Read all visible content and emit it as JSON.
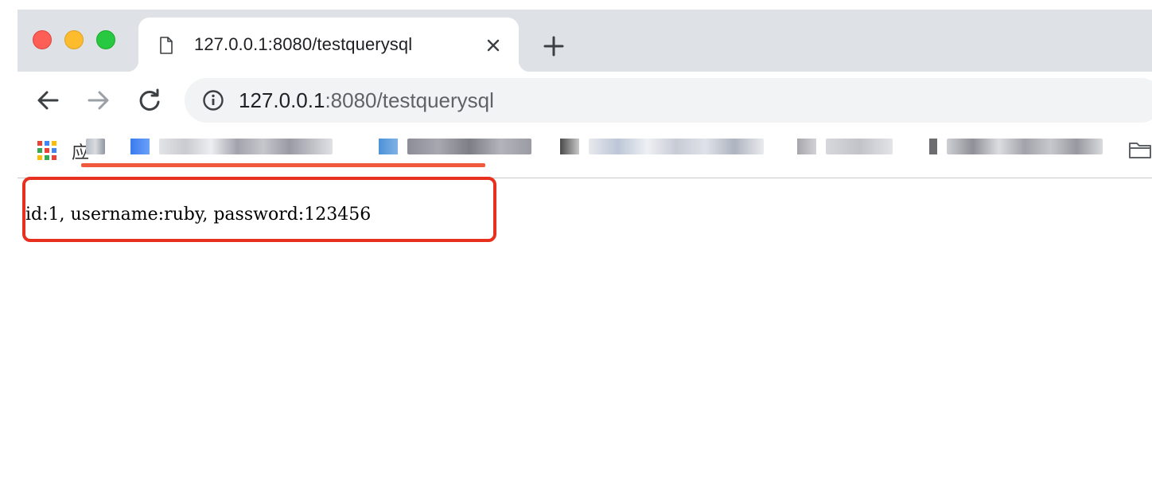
{
  "window": {
    "traffic_lights": [
      "close",
      "minimize",
      "maximize"
    ]
  },
  "tab": {
    "icon": "file-icon",
    "title": "127.0.0.1:8080/testquerysql",
    "close_icon": "close-icon"
  },
  "newtab": {
    "icon": "plus-icon"
  },
  "toolbar": {
    "back_icon": "arrow-left-icon",
    "forward_icon": "arrow-right-icon",
    "reload_icon": "reload-icon",
    "info_icon": "info-icon",
    "url_host": "127.0.0.1",
    "url_rest": ":8080/testquerysql"
  },
  "bookmarks": {
    "apps_icon": "apps-grid-icon",
    "partial_label": "应",
    "items_blurred": true,
    "folder_icon": "folder-icon"
  },
  "page": {
    "result": "id:1, username:ruby, password:123456"
  },
  "colors": {
    "tabstrip": "#dee1e6",
    "omnibox": "#f1f3f4",
    "annotation_red": "#e8301e",
    "close_light": "#fd5f57",
    "min_light": "#fdbb2e",
    "max_light": "#28c840"
  }
}
